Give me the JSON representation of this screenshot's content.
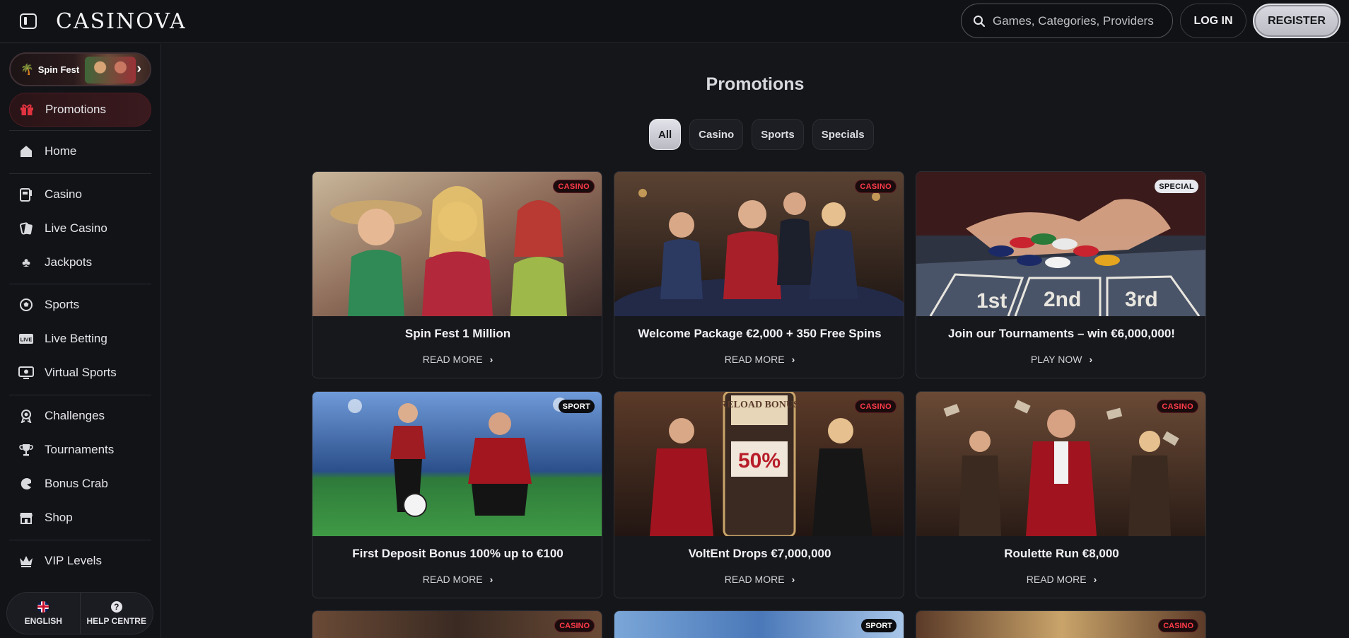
{
  "header": {
    "logo": "CASINOVA",
    "search_placeholder": "Games, Categories, Providers",
    "login_label": "LOG IN",
    "register_label": "REGISTER"
  },
  "sidebar": {
    "banner_label": "Spin Fest",
    "promotions_label": "Promotions",
    "items": [
      {
        "label": "Home",
        "icon": "home-icon"
      },
      {
        "label": "Casino",
        "icon": "slot-machine-icon"
      },
      {
        "label": "Live Casino",
        "icon": "live-cards-icon"
      },
      {
        "label": "Jackpots",
        "icon": "clover-icon"
      },
      {
        "label": "Sports",
        "icon": "soccer-ball-icon"
      },
      {
        "label": "Live Betting",
        "icon": "live-badge-icon"
      },
      {
        "label": "Virtual Sports",
        "icon": "monitor-icon"
      },
      {
        "label": "Challenges",
        "icon": "medal-icon"
      },
      {
        "label": "Tournaments",
        "icon": "trophy-icon"
      },
      {
        "label": "Bonus Crab",
        "icon": "crab-claw-icon"
      },
      {
        "label": "Shop",
        "icon": "shop-icon"
      },
      {
        "label": "VIP Levels",
        "icon": "crown-icon"
      }
    ],
    "footer": {
      "language": "ENGLISH",
      "help": "HELP CENTRE"
    }
  },
  "main": {
    "title": "Promotions",
    "filters": [
      "All",
      "Casino",
      "Sports",
      "Specials"
    ],
    "active_filter": "All",
    "cards": [
      {
        "title": "Spin Fest 1 Million",
        "badge": "CASINO",
        "cta": "READ MORE"
      },
      {
        "title": "Welcome Package €2,000 + 350 Free Spins",
        "badge": "CASINO",
        "cta": "READ MORE"
      },
      {
        "title": "Join our Tournaments – win €6,000,000!",
        "badge": "SPECIAL",
        "cta": "PLAY NOW"
      },
      {
        "title": "First Deposit Bonus 100% up to €100",
        "badge": "SPORT",
        "cta": "READ MORE"
      },
      {
        "title": "VoltEnt Drops €7,000,000",
        "badge": "CASINO",
        "cta": "READ MORE"
      },
      {
        "title": "Roulette Run €8,000",
        "badge": "CASINO",
        "cta": "READ MORE"
      }
    ],
    "partial_cards": [
      {
        "badge": "CASINO"
      },
      {
        "badge": "SPORT"
      },
      {
        "badge": "CASINO"
      }
    ],
    "image_text": {
      "reload_bonus": "RELOAD BONUS",
      "percent": "50%",
      "places": [
        "1st",
        "2nd",
        "3rd"
      ]
    }
  }
}
